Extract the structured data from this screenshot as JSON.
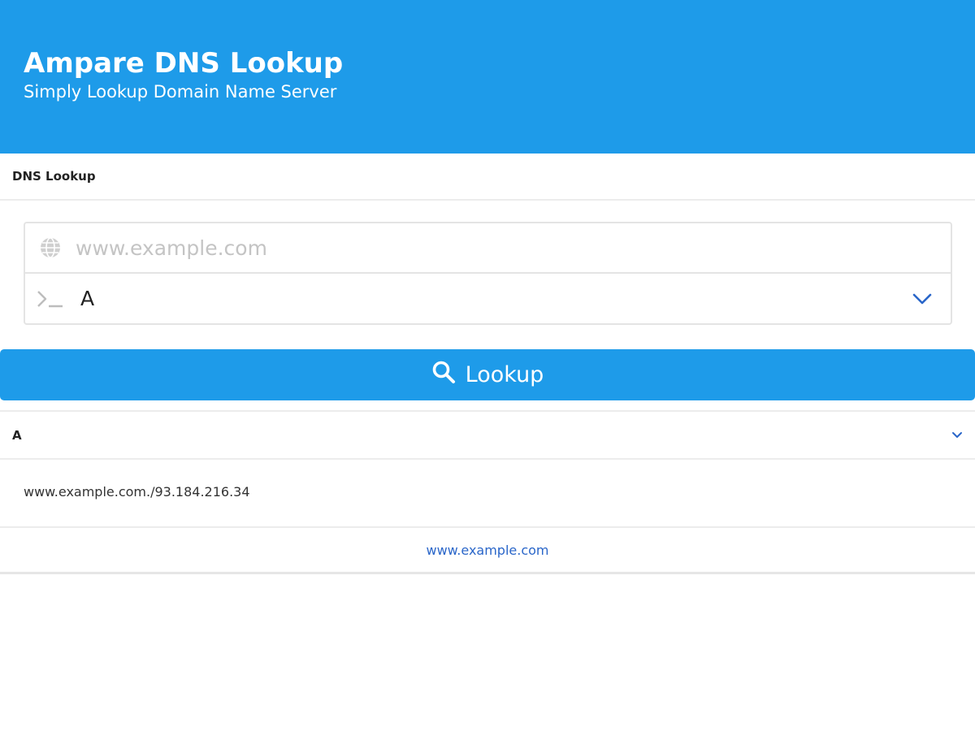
{
  "header": {
    "title": "Ampare DNS Lookup",
    "subtitle": "Simply Lookup Domain Name Server"
  },
  "card": {
    "title": "DNS Lookup"
  },
  "form": {
    "domain_placeholder": "www.example.com",
    "domain_value": "",
    "record_type": "A",
    "lookup_label": "Lookup"
  },
  "result": {
    "record_type": "A",
    "entry": "www.example.com./93.184.216.34",
    "link_text": "www.example.com"
  },
  "colors": {
    "primary": "#1e9be9",
    "link": "#2a66c9"
  },
  "icons": {
    "domain_field": "globe-icon",
    "type_field": "terminal-icon",
    "select": "chevron-down-icon",
    "button": "search-icon",
    "result_toggle": "chevron-down-icon"
  }
}
